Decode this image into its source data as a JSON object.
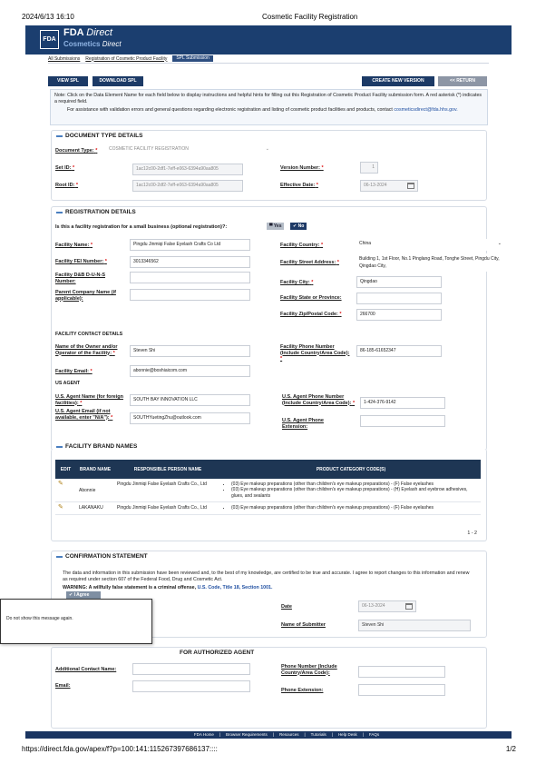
{
  "print": {
    "date": "2024/6/13 16:10",
    "title": "Cosmetic Facility Registration",
    "url": "https://direct.fda.gov/apex/f?p=100:141:115267397686137::::",
    "page": "1/2"
  },
  "header": {
    "logo": "FDA",
    "title_a": "FDA",
    "title_b": "Direct",
    "sub_a": "Cosmetics",
    "sub_b": "Direct"
  },
  "breadcrumbs": {
    "b1": "All Submissions",
    "b2": "Registration of Cosmetic Product Facility",
    "b3": "SPL Submission"
  },
  "toolbar": {
    "view": "VIEW SPL",
    "download": "DOWNLOAD SPL",
    "create": "CREATE NEW VERSION",
    "ret": "<< RETURN"
  },
  "note": {
    "text1": "Note: Click on the Data Element Name for each field below to display instructions and helpful hints for filling out this Registration of Cosmetic Product Facility submission form. A red asterisk (*) indicates a required field.",
    "text2": "For assistance with validation errors and general questions regarding electronic registration and listing of cosmetic product facilities and products, contact",
    "email": "cosmeticsdirect@fda.hhs.gov."
  },
  "doctype": {
    "heading": "DOCUMENT TYPE DETAILS",
    "doc_label": "Document Type:",
    "doc_value": "COSMETIC FACILITY REGISTRATION",
    "setid_label": "Set ID:",
    "setid": "1ac12c00-2df1-7eff-e063-6394a90aa805",
    "rootid_label": "Root ID:",
    "rootid": "1ac12c00-2df2-7eff-e063-6394a90aa805",
    "version_label": "Version Number:",
    "version": "1",
    "eff_label": "Effective Date:",
    "eff": "06-13-2024"
  },
  "registration": {
    "heading": "REGISTRATION DETAILS",
    "small_q": "Is this a facility registration for a small business (optional registration)?:",
    "yes": "Yes",
    "no": "No",
    "name_label": "Facility Name:",
    "name": "Pingdu Jinmiqi False Eyelash Crafts Co Ltd",
    "fei_label": "Facility FEI Number:",
    "fei": "3013346562",
    "duns_label": "Facility D&B D-U-N-S Number:",
    "parent_label": "Parent Company Name (if applicable):",
    "country_label": "Facility Country:",
    "country": "China",
    "street_label": "Facility Street Address:",
    "street": "Building 1, 1st Floor, No.1 Pinglang Road, Tonghe Street, Pingdu City, Qingdao City,",
    "city_label": "Facility City:",
    "city": "Qingdao",
    "state_label": "Facility State or Province:",
    "zip_label": "Facility Zip/Postal Code:",
    "zip": "266700",
    "contact_heading": "FACILITY CONTACT DETAILS",
    "owner_label": "Name of the Owner and/or Operator of the Facility:",
    "owner": "Steven Shi",
    "email_label": "Facility Email:",
    "email": "abonnie@boshiaicom.com",
    "phone_label": "Facility Phone Number (Include Country/Area Code):",
    "phone": "86-185-61652347",
    "agent_heading": "US AGENT",
    "agent_label": "U.S. Agent Name (for foreign facilities):",
    "agent": "SOUTH BAY INNOVATION LLC",
    "agent_email_label": "U.S. Agent Email (if not available, enter \"N/A\"):",
    "agent_email": "SOUTHYuetingZhu@outlook.com",
    "agent_phone_label": "U.S. Agent Phone Number (Include Country/Area Code):",
    "agent_phone": "1-424-376-9142",
    "agent_ext_label": "U.S. Agent Phone Extension:"
  },
  "brands": {
    "heading": "FACILITY BRAND NAMES",
    "cols": [
      "EDIT",
      "BRAND NAME",
      "RESPONSIBLE PERSON NAME",
      "PRODUCT CATEGORY CODE(S)"
    ],
    "rows": [
      {
        "brand": "Abonnie",
        "person": "Pingdu Jinmiqi False Eyelash Crafts Co., Ltd",
        "codes": [
          "(03) Eye makeup preparations (other than children's eye makeup preparations) - (F) False eyelashes",
          "(03) Eye makeup preparations (other than children's eye makeup preparations) - (H) Eyelash and eyebrow adhesives, glues, and sealants"
        ]
      },
      {
        "brand": "LAKANAKU",
        "person": "Pingdu Jinmiqi False Eyelash Crafts Co., Ltd",
        "codes": [
          "(03) Eye makeup preparations (other than children's eye makeup preparations) - (F) False eyelashes"
        ]
      }
    ],
    "pager": "1 - 2"
  },
  "confirm": {
    "heading": "CONFIRMATION STATEMENT",
    "text": "The data and information in this submission have been reviewed and, to the best of my knowledge, are certified to be true and accurate. I agree to report changes to this information and renew as required under section 607 of the Federal Food, Drug and Cosmetic Act.",
    "warn": "WARNING: A willfully false statement is a criminal offense,",
    "warn_link": "U.S. Code, Title 18, Section 1001.",
    "agree": "I Agree",
    "date_label": "Date",
    "date": "06-13-2024",
    "submitter_label": "Name of Submitter",
    "submitter": "Steven Shi"
  },
  "popup": {
    "text": "Do not show this message again."
  },
  "authorized": {
    "heading": "FOR AUTHORIZED AGENT",
    "addl_label": "Additional Contact Name:",
    "email_label": "Email:",
    "phone_label": "Phone Number (Include Country/Area Code):",
    "ext_label": "Phone Extension:"
  },
  "footer": {
    "f1": "FDA Home",
    "f2": "Browser Requirements",
    "f3": "Resources",
    "f4": "Tutorials",
    "f5": "Help Desk",
    "f6": "FAQs"
  }
}
